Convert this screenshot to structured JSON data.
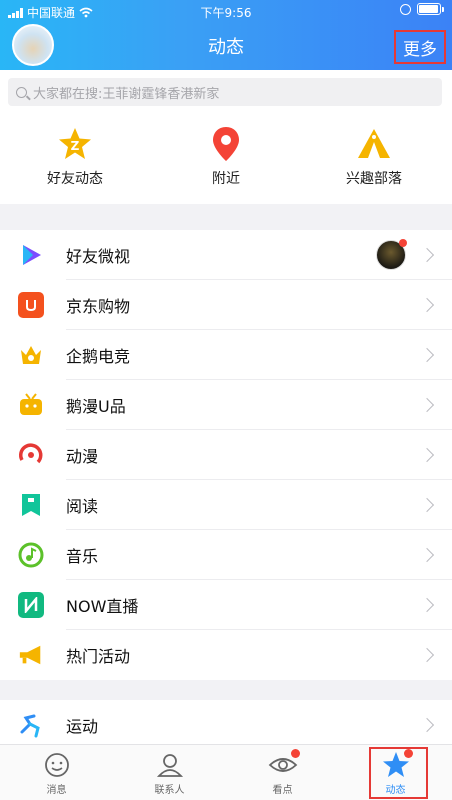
{
  "status_bar": {
    "carrier": "中国联通",
    "time": "下午9:56"
  },
  "header": {
    "title": "动态",
    "more_label": "更多"
  },
  "search": {
    "placeholder": "大家都在搜:王菲谢霆锋香港新家"
  },
  "shortcuts": [
    {
      "label": "好友动态",
      "icon": "star-badge-icon"
    },
    {
      "label": "附近",
      "icon": "location-pin-icon"
    },
    {
      "label": "兴趣部落",
      "icon": "tent-icon"
    }
  ],
  "list": [
    {
      "label": "好友微视",
      "icon": "play-icon",
      "color": "#7c4dff"
    },
    {
      "label": "京东购物",
      "icon": "jd-icon",
      "color": "#f4511e"
    },
    {
      "label": "企鹅电竞",
      "icon": "crown-icon",
      "color": "#f5b400"
    },
    {
      "label": "鹅漫U品",
      "icon": "tv-icon",
      "color": "#f5b400"
    },
    {
      "label": "动漫",
      "icon": "comic-icon",
      "color": "#e53935"
    },
    {
      "label": "阅读",
      "icon": "book-icon",
      "color": "#11c59a"
    },
    {
      "label": "音乐",
      "icon": "music-icon",
      "color": "#5cc12a"
    },
    {
      "label": "NOW直播",
      "icon": "now-live-icon",
      "color": "#11b980"
    },
    {
      "label": "热门活动",
      "icon": "megaphone-icon",
      "color": "#f5b400"
    }
  ],
  "list2": [
    {
      "label": "运动",
      "icon": "run-icon",
      "color": "#2f8ef5"
    }
  ],
  "tabs": [
    {
      "label": "消息",
      "icon": "message-smile-icon"
    },
    {
      "label": "联系人",
      "icon": "contacts-icon"
    },
    {
      "label": "看点",
      "icon": "eye-icon"
    },
    {
      "label": "动态",
      "icon": "star-icon"
    }
  ],
  "colors": {
    "accent": "#2f8ef5",
    "highlight_box": "#e53935",
    "badge": "#f44336"
  }
}
